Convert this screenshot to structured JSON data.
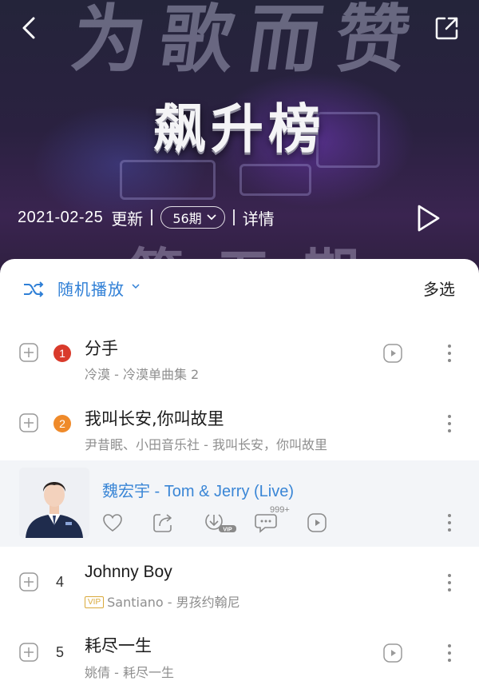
{
  "banner": {
    "logo_text": "为歌而赞",
    "title": "飙升榜",
    "bottom_text": "第五期",
    "date": "2021-02-25",
    "update_label": "更新",
    "issue_label": "56期",
    "detail_label": "详情"
  },
  "toolbar": {
    "shuffle_label": "随机播放",
    "multi_select_label": "多选"
  },
  "songs": [
    {
      "rank": "1",
      "title": "分手",
      "subtitle": "冷漠 - 冷漠单曲集 2"
    },
    {
      "rank": "2",
      "title": "我叫长安,你叫故里",
      "subtitle": "尹昔眠、小田音乐社 - 我叫长安，你叫故里"
    },
    {
      "rank": "4",
      "title": "Johnny Boy",
      "vip": "VIP",
      "subtitle": "Santiano - 男孩约翰尼"
    },
    {
      "rank": "5",
      "title": "耗尽一生",
      "subtitle": "姚倩 - 耗尽一生"
    }
  ],
  "now_playing": {
    "title": "魏宏宇 - Tom & Jerry (Live)",
    "comment_count": "999+"
  },
  "colors": {
    "accent": "#2f7fd6",
    "rank1": "#d93a2b",
    "rank2": "#ef8a2a",
    "vip": "#d9a93a"
  },
  "icons": [
    "back-icon",
    "share-icon",
    "play-icon",
    "chevron-down-icon",
    "shuffle-icon",
    "add-icon",
    "mv-play-icon",
    "more-icon",
    "heart-icon",
    "share-song-icon",
    "download-vip-icon",
    "comment-icon"
  ]
}
